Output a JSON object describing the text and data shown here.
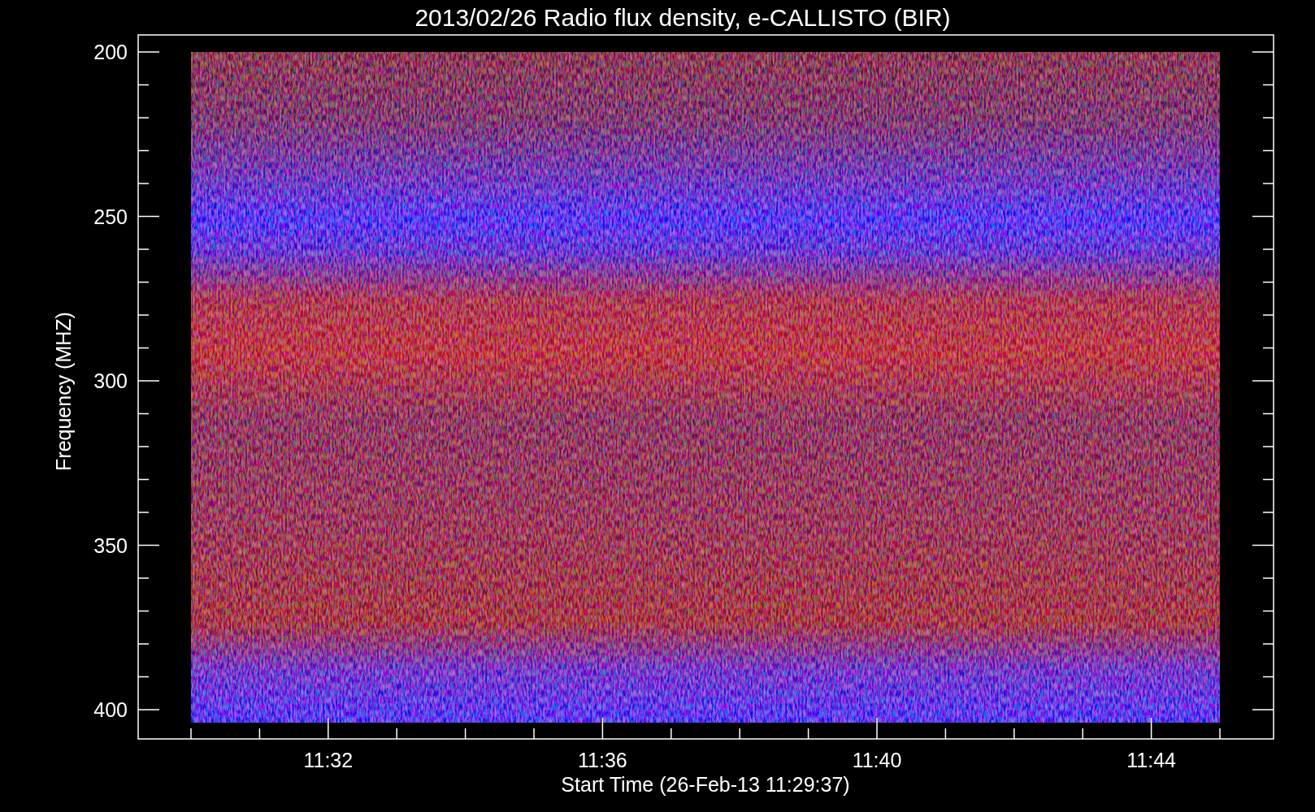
{
  "title": "2013/02/26  Radio flux density, e-CALLISTO (BIR)",
  "plot": {
    "ylabel": "Frequency (MHZ)",
    "xlabel": "Start Time (26-Feb-13 11:29:37)",
    "yticks": [
      "200",
      "250",
      "300",
      "350",
      "400"
    ],
    "xticks": [
      "11:32",
      "11:36",
      "11:40",
      "11:44"
    ]
  }
}
